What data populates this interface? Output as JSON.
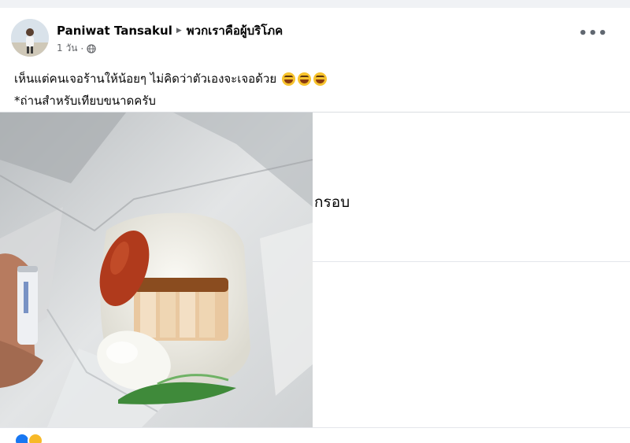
{
  "post": {
    "author": "Paniwat Tansakul",
    "group": "พวกเราคือผู้บริโภค",
    "time": "1 วัน",
    "more_label": "•••",
    "text_line1": "เห็นแต่คนเจอร้านให้น้อยๆ ไม่คิดว่าตัวเองจะเจอด้วย",
    "text_line2": "*ถ่านสำหรับเทียบขนาดครับ",
    "emoji_name": "rolling-on-floor-laughing-emoji"
  },
  "side_panel": {
    "partial_text": "กรอบ"
  },
  "reactions": {
    "colors": [
      "#1877f2",
      "#f7b928"
    ]
  }
}
